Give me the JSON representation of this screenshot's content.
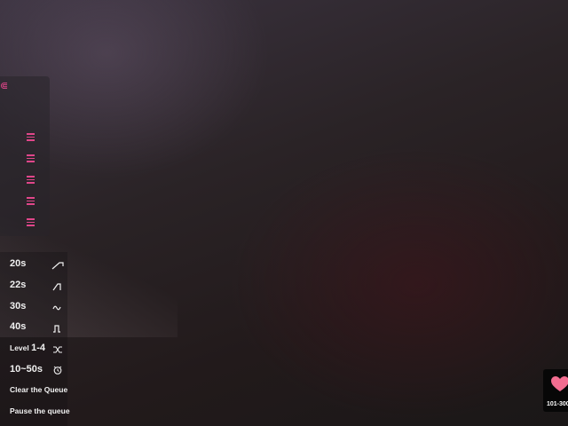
{
  "colors": {
    "accent": "#e0468a",
    "badge": "#070707",
    "text": "#f0f0f0"
  },
  "sidebar": {
    "logo": "logo-icon",
    "items": [
      {
        "icon": "menu-icon"
      },
      {
        "icon": "menu-icon"
      },
      {
        "icon": "menu-icon"
      },
      {
        "icon": "menu-icon"
      },
      {
        "icon": "menu-icon"
      }
    ]
  },
  "presets": [
    {
      "label": "20s",
      "icon": "ramp-up-icon"
    },
    {
      "label": "22s",
      "icon": "step-up-icon"
    },
    {
      "label": "30s",
      "icon": "wave-icon"
    },
    {
      "label": "40s",
      "icon": "pulse-icon"
    },
    {
      "label_prefix": "Level ",
      "label_value": "1-4",
      "icon": "shuffle-icon"
    },
    {
      "label": "10~50s",
      "icon": "alarm-icon"
    }
  ],
  "actions": {
    "clear_queue": "Clear the Queue",
    "pause_queue": "Pause the queue"
  },
  "tip_badge": {
    "icon": "heart-icon",
    "range": "101-300"
  }
}
